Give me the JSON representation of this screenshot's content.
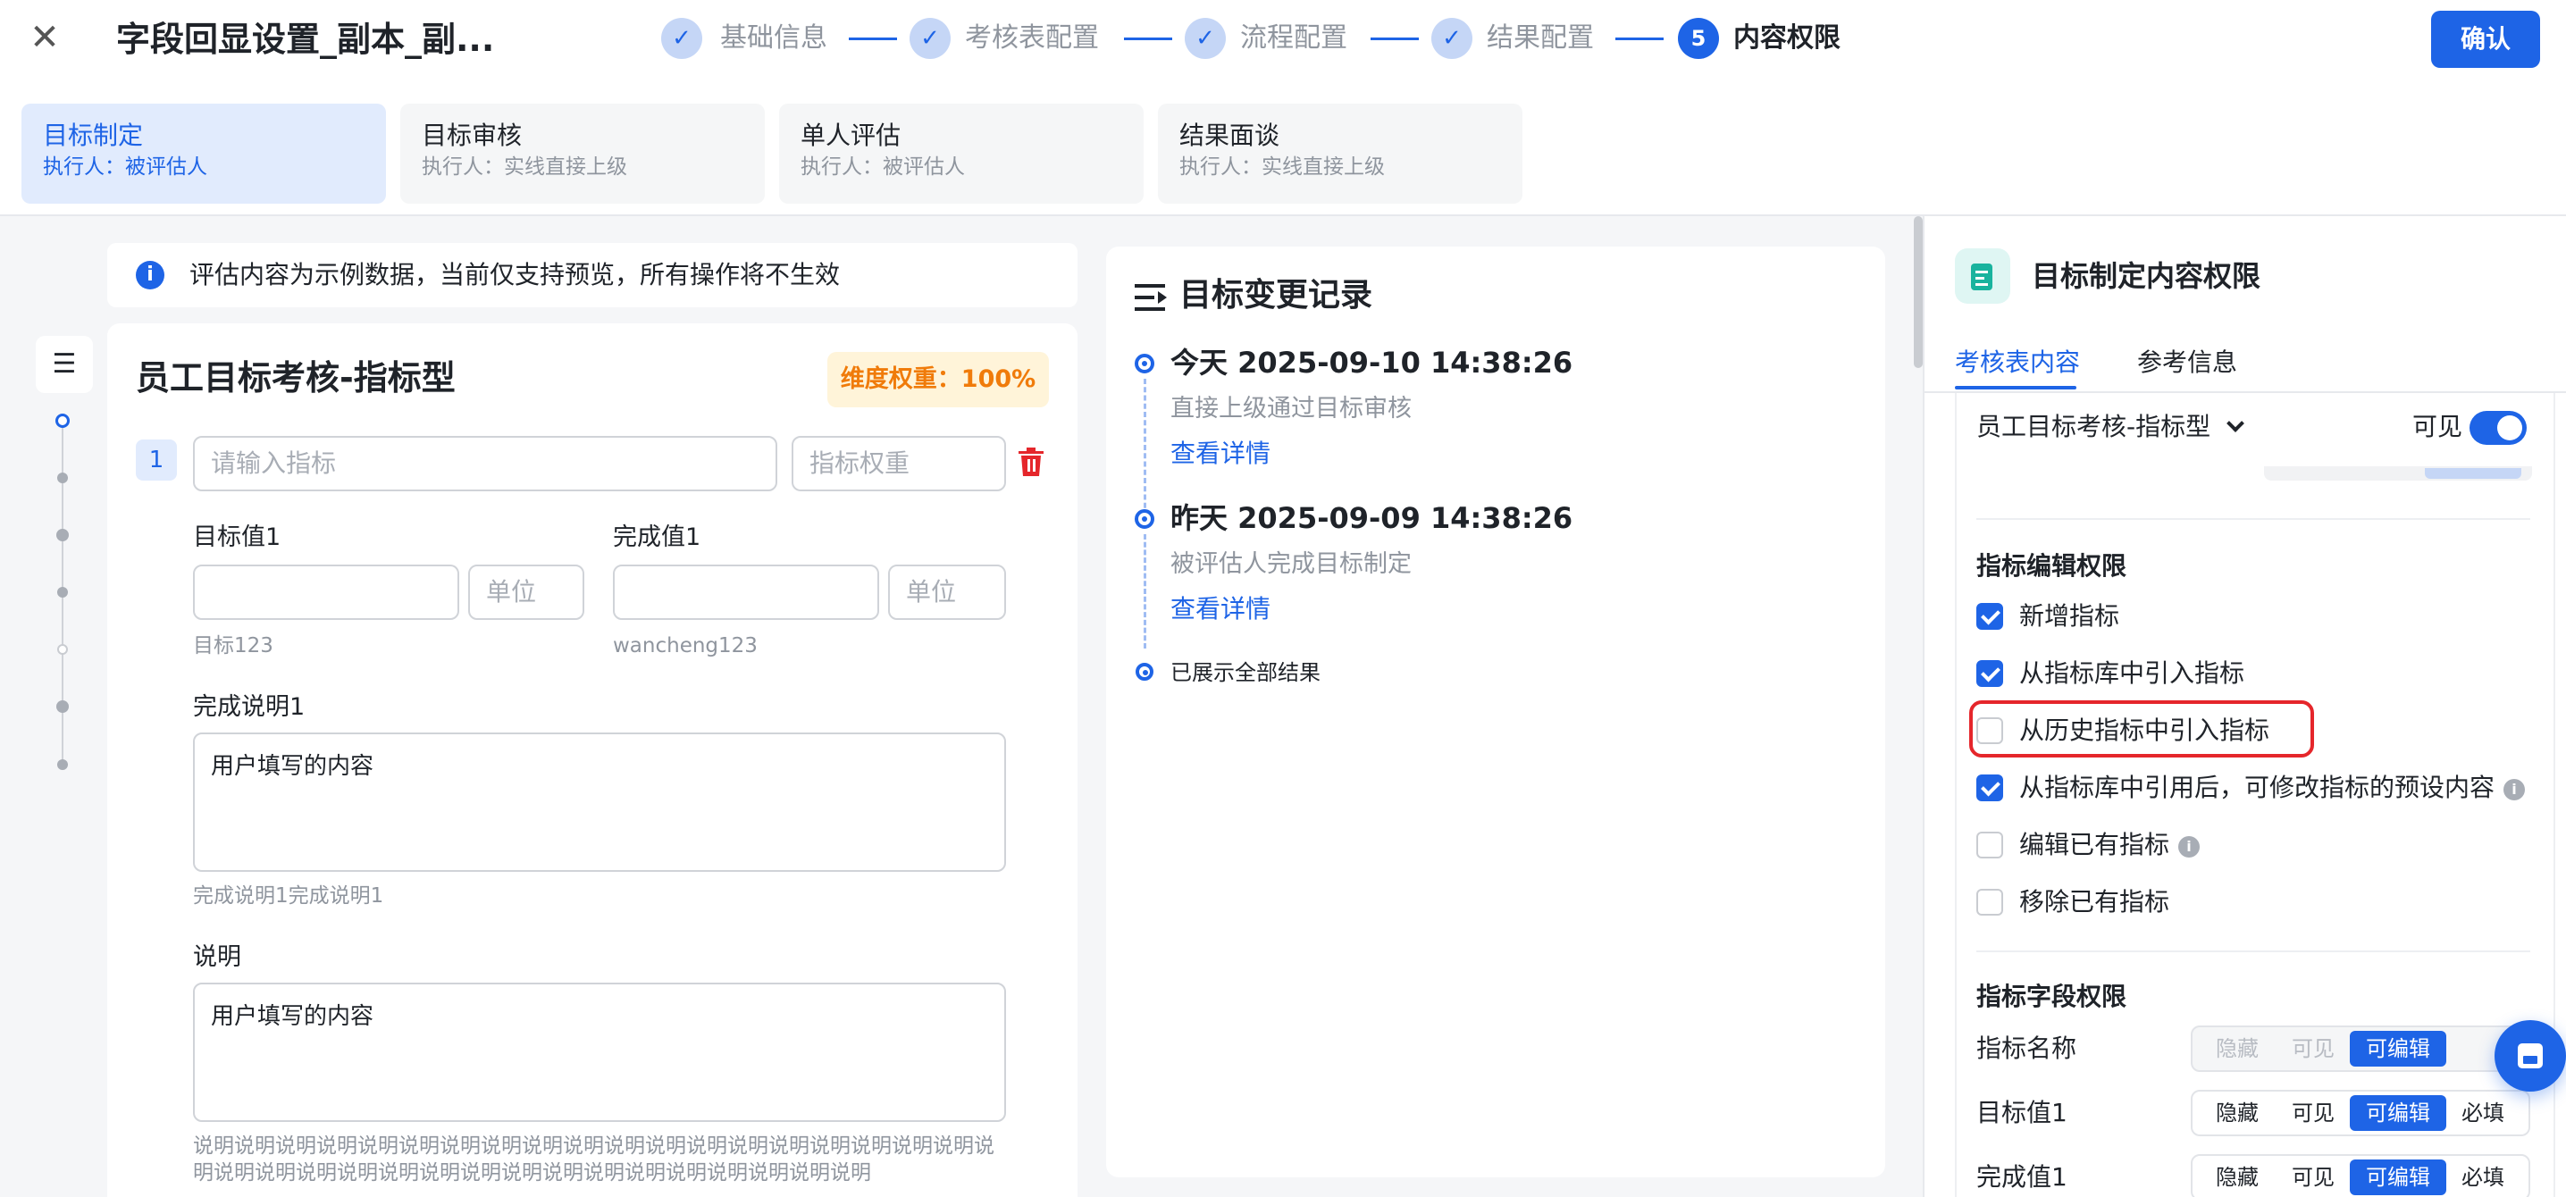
{
  "header": {
    "close_icon": "close-icon",
    "title": "字段回显设置_副本_副...",
    "steps": [
      {
        "label": "基础信息",
        "done": true
      },
      {
        "label": "考核表配置",
        "done": true
      },
      {
        "label": "流程配置",
        "done": true
      },
      {
        "label": "结果配置",
        "done": true
      },
      {
        "label": "内容权限",
        "number": "5",
        "active": true
      }
    ],
    "confirm_label": "确认",
    "accent_color": "#1e64e6"
  },
  "stages": [
    {
      "name": "目标制定",
      "executor": "执行人：被评估人",
      "active": true
    },
    {
      "name": "目标审核",
      "executor": "执行人：实线直接上级"
    },
    {
      "name": "单人评估",
      "executor": "执行人：被评估人"
    },
    {
      "name": "结果面谈",
      "executor": "执行人：实线直接上级"
    }
  ],
  "notice": {
    "icon": "info-icon",
    "text": "评估内容为示例数据，当前仅支持预览，所有操作将不生效"
  },
  "form": {
    "title": "员工目标考核-指标型",
    "weight_badge": "维度权重：100%",
    "row_index": "1",
    "indicator_placeholder": "请输入指标",
    "weight_placeholder": "指标权重",
    "target_label": "目标值1",
    "target_unit_placeholder": "单位",
    "target_hint": "目标123",
    "completion_label": "完成值1",
    "completion_unit_placeholder": "单位",
    "completion_hint": "wancheng123",
    "completion_desc_label": "完成说明1",
    "completion_desc_value": "用户填写的内容",
    "completion_desc_hint": "完成说明1完成说明1",
    "desc_label": "说明",
    "desc_value": "用户填写的内容",
    "desc_hint": "说明说明说明说明说明说明说明说明说明说明说明说明说明说明说明说明说明说明说明说明说明说明说明说明说明说明说明说明说明说明说明说明说明说明说明说明"
  },
  "timeline": {
    "title": "目标变更记录",
    "entries": [
      {
        "time": "今天 2025-09-10 14:38:26",
        "desc": "直接上级通过目标审核",
        "link": "查看详情"
      },
      {
        "time": "昨天 2025-09-09 14:38:26",
        "desc": "被评估人完成目标制定",
        "link": "查看详情"
      }
    ],
    "end_text": "已展示全部结果"
  },
  "panel": {
    "title": "目标制定内容权限",
    "tabs": [
      {
        "label": "考核表内容",
        "active": true
      },
      {
        "label": "参考信息"
      }
    ],
    "section_name": "员工目标考核-指标型",
    "visible_label": "可见",
    "visible_on": true,
    "edit_group_title": "指标编辑权限",
    "permissions": [
      {
        "label": "新增指标",
        "checked": true
      },
      {
        "label": "从指标库中引入指标",
        "checked": true
      },
      {
        "label": "从历史指标中引入指标",
        "checked": false,
        "highlighted": true
      },
      {
        "label": "从指标库中引用后，可修改指标的预设内容",
        "checked": true,
        "info": true
      },
      {
        "label": "编辑已有指标",
        "checked": false,
        "info": true
      },
      {
        "label": "移除已有指标",
        "checked": false
      }
    ],
    "field_group_title": "指标字段权限",
    "field_options": [
      "隐藏",
      "可见",
      "可编辑",
      "必填"
    ],
    "fields": [
      {
        "label": "指标名称",
        "selected": "可编辑",
        "disabled": true
      },
      {
        "label": "目标值1",
        "selected": "可编辑"
      },
      {
        "label": "完成值1",
        "selected": "可编辑"
      }
    ]
  }
}
